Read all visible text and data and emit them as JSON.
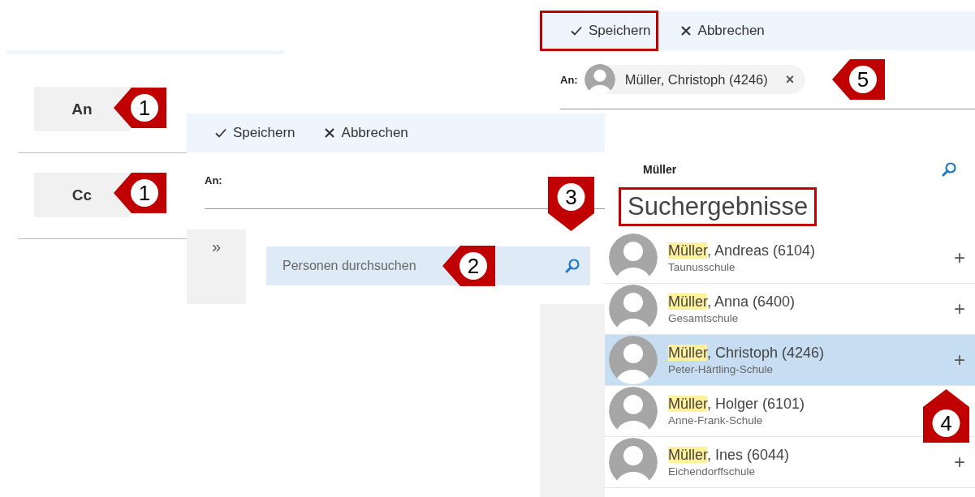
{
  "panel_recipient_buttons": {
    "buttons": [
      {
        "label": "An"
      },
      {
        "label": "Cc"
      }
    ]
  },
  "panel_empty_form": {
    "toolbar": [
      {
        "kind": "save",
        "label": "Speichern",
        "outlined": false
      },
      {
        "kind": "cancel",
        "label": "Abbrechen",
        "outlined": false
      }
    ],
    "to_label": "An:",
    "expand_label": "»",
    "search": {
      "placeholder": "Personen durchsuchen"
    }
  },
  "panel_results": {
    "toolbar": [
      {
        "kind": "save",
        "label": "Speichern",
        "outlined": true
      },
      {
        "kind": "cancel",
        "label": "Abbrechen",
        "outlined": false
      }
    ],
    "to_label": "An:",
    "recipient": {
      "name": "Müller, Christoph (4246)",
      "remove": "×"
    },
    "search": {
      "value": "Müller"
    },
    "heading": "Suchergebnisse",
    "heading_outlined": true,
    "results": [
      {
        "name": [
          {
            "text": "Müller",
            "highlighted": true
          },
          {
            "text": ", Andreas (6104)",
            "highlighted": false
          }
        ],
        "school": "Taunusschule",
        "selected": false,
        "add": "+"
      },
      {
        "name": [
          {
            "text": "Müller",
            "highlighted": true
          },
          {
            "text": ", Anna (6400)",
            "highlighted": false
          }
        ],
        "school": "Gesamtschule",
        "selected": false,
        "add": "+"
      },
      {
        "name": [
          {
            "text": "Müller",
            "highlighted": true
          },
          {
            "text": ", Christoph (4246)",
            "highlighted": false
          }
        ],
        "school": "Peter-Härtling-Schule",
        "selected": true,
        "add": "+"
      },
      {
        "name": [
          {
            "text": "Müller",
            "highlighted": true
          },
          {
            "text": ", Holger (6101)",
            "highlighted": false
          }
        ],
        "school": "Anne-Frank-Schule",
        "selected": false
      },
      {
        "name": [
          {
            "text": "Müller",
            "highlighted": true
          },
          {
            "text": ", Ines (6044)",
            "highlighted": false
          }
        ],
        "school": "Eichendorffschule",
        "selected": false,
        "add": "+"
      }
    ]
  },
  "callouts": [
    {
      "number": "1",
      "kind": "left"
    },
    {
      "number": "1",
      "kind": "left"
    },
    {
      "number": "2",
      "kind": "left"
    },
    {
      "number": "3",
      "kind": "down"
    },
    {
      "number": "4",
      "kind": "up"
    },
    {
      "number": "5",
      "kind": "left"
    }
  ]
}
